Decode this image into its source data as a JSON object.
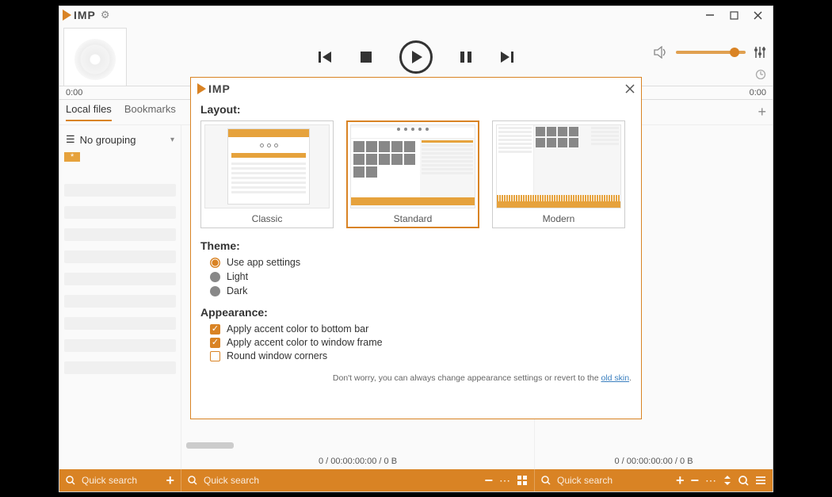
{
  "app_name": "IMP",
  "titlebar": {
    "gear": "⚙"
  },
  "time": {
    "left": "0:00",
    "right": "0:00"
  },
  "tabs": {
    "local": "Local files",
    "bookmarks": "Bookmarks"
  },
  "grouping": {
    "label": "No grouping"
  },
  "column_status": {
    "mid": "0 / 00:00:00:00 / 0 B",
    "right": "0 / 00:00:00:00 / 0 B"
  },
  "search": {
    "placeholder": "Quick search"
  },
  "dialog": {
    "app": "IMP",
    "layout_label": "Layout:",
    "layouts": {
      "classic": "Classic",
      "standard": "Standard",
      "modern": "Modern"
    },
    "theme_label": "Theme:",
    "themes": {
      "app": "Use app settings",
      "light": "Light",
      "dark": "Dark"
    },
    "appearance_label": "Appearance:",
    "checks": {
      "accent_bottom": "Apply accent color to bottom bar",
      "accent_frame": "Apply accent color to window frame",
      "round": "Round window corners"
    },
    "hint_prefix": "Don't worry, you can always change appearance settings or revert to the ",
    "hint_link": "old skin",
    "hint_suffix": "."
  }
}
